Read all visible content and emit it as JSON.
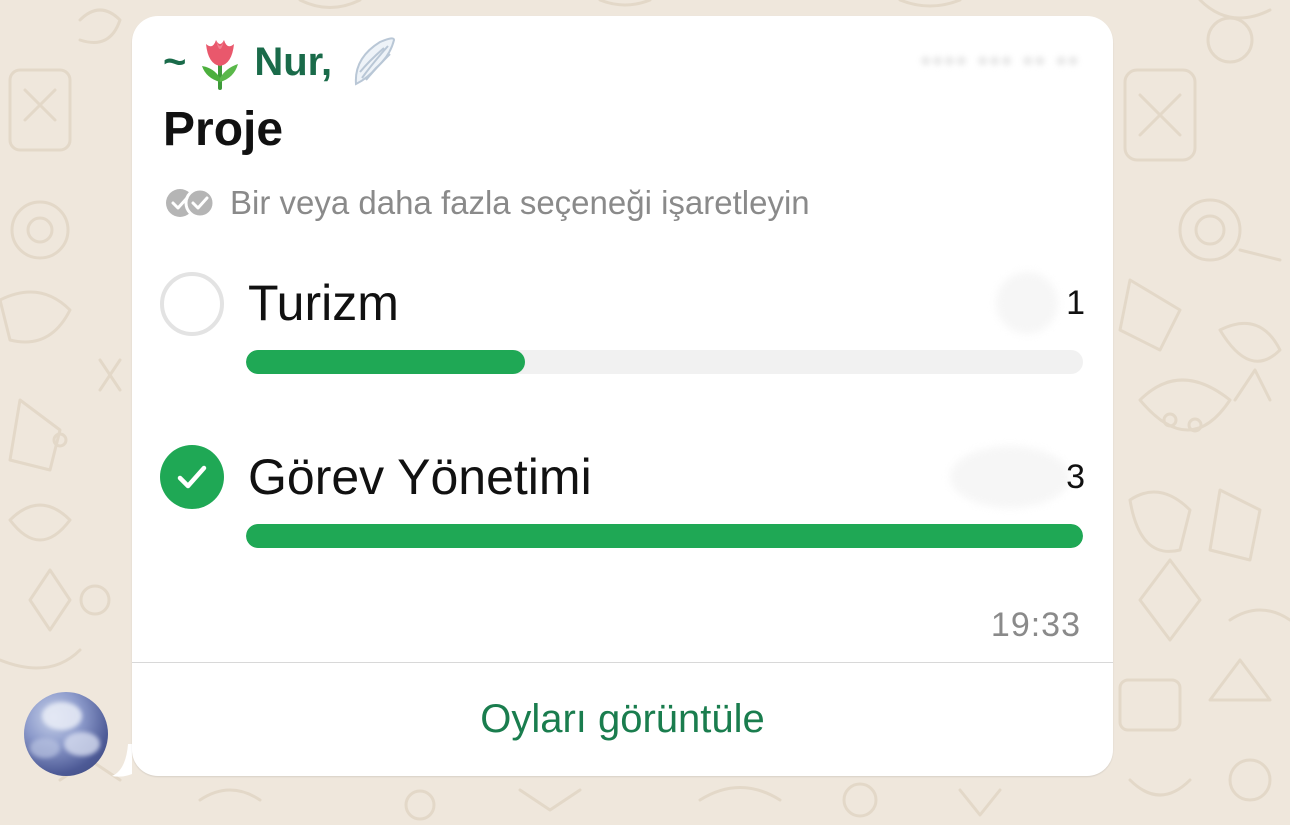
{
  "message": {
    "sender_prefix": "~",
    "sender_name": "Nur,",
    "sender_emoji_left": "tulip-emoji",
    "sender_emoji_right": "wing-emoji",
    "poll": {
      "title": "Proje",
      "instruction": "Bir veya daha fazla seçeneği işaretleyin",
      "options": [
        {
          "label": "Turizm",
          "votes": "1",
          "selected": false,
          "fraction": 0.333
        },
        {
          "label": "Görev Yönetimi",
          "votes": "3",
          "selected": true,
          "fraction": 1.0
        }
      ]
    },
    "time": "19:33",
    "action_label": "Oyları görüntüle"
  },
  "colors": {
    "accent_green": "#1fa855",
    "sender_green": "#1a6b4a",
    "action_green": "#1a7d4e",
    "track_gray": "#f1f1f1",
    "wallpaper": "#efe7dc"
  }
}
